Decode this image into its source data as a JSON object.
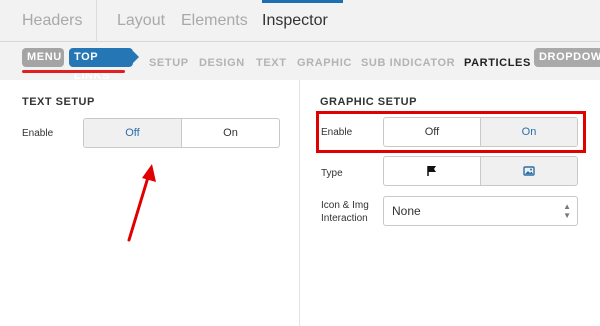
{
  "top_tabs": [
    {
      "label": "Headers"
    },
    {
      "label": "Layout"
    },
    {
      "label": "Elements"
    },
    {
      "label": "Inspector"
    }
  ],
  "sub_tabs": {
    "menu": "MENU",
    "top_links": "TOP LINKS",
    "setup": "SETUP",
    "design": "DESIGN",
    "text": "TEXT",
    "graphic": "GRAPHIC",
    "sub_indicator": "SUB INDICATOR",
    "particles": "PARTICLES",
    "dropdown": "DROPDOWN"
  },
  "text_setup": {
    "title": "TEXT SETUP",
    "enable_label": "Enable",
    "off_label": "Off",
    "on_label": "On",
    "selected": "Off"
  },
  "graphic_setup": {
    "title": "GRAPHIC SETUP",
    "enable_label": "Enable",
    "off_label": "Off",
    "on_label": "On",
    "selected": "On",
    "type_label": "Type",
    "type_options": [
      "flag-icon",
      "image-icon"
    ],
    "type_selected": "image-icon",
    "icon_interaction_label_line1": "Icon & Img",
    "icon_interaction_label_line2": "Interaction",
    "icon_interaction_value": "None"
  },
  "colors": {
    "accent": "#2576b5",
    "annotation_red": "#e00000"
  }
}
